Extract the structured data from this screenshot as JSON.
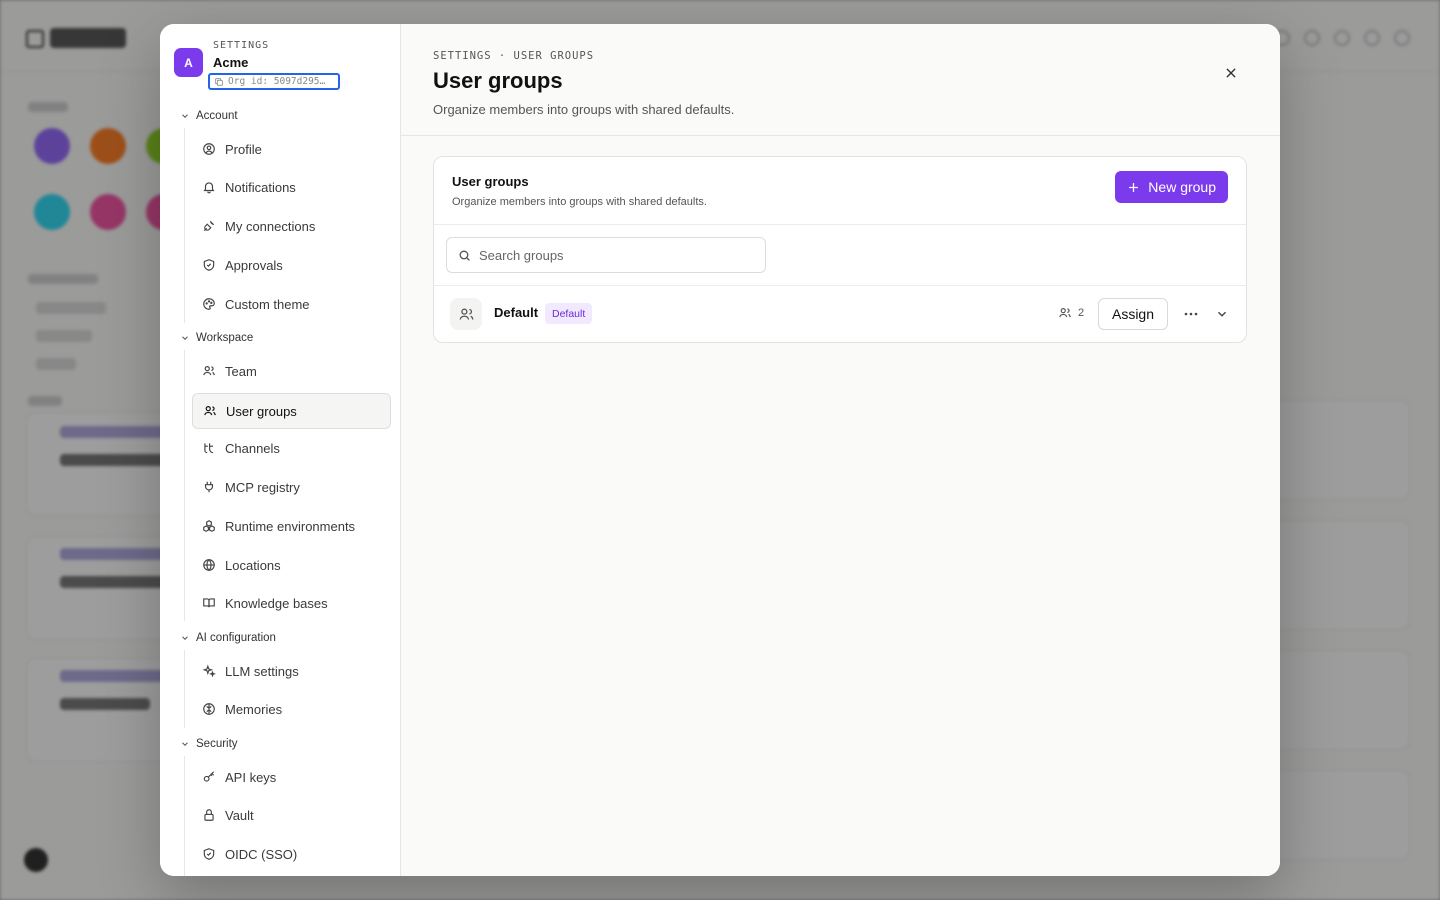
{
  "settings": {
    "org": {
      "kicker": "SETTINGS",
      "avatar_initial": "A",
      "name": "Acme",
      "id": "Org id: 5097d295…"
    },
    "sections": [
      {
        "label": "Account",
        "items": [
          {
            "label": "Profile",
            "icon": "user-circle-icon"
          },
          {
            "label": "Notifications",
            "icon": "bell-icon"
          },
          {
            "label": "My connections",
            "icon": "plug-icon"
          },
          {
            "label": "Approvals",
            "icon": "shield-check-icon"
          },
          {
            "label": "Custom theme",
            "icon": "palette-icon"
          }
        ]
      },
      {
        "label": "Workspace",
        "items": [
          {
            "label": "Team",
            "icon": "users-icon"
          },
          {
            "label": "User groups",
            "icon": "users-icon",
            "active": true
          },
          {
            "label": "Channels",
            "icon": "channels-icon"
          },
          {
            "label": "MCP registry",
            "icon": "plug-icon"
          },
          {
            "label": "Runtime environments",
            "icon": "boxes-icon"
          },
          {
            "label": "Locations",
            "icon": "globe-icon"
          },
          {
            "label": "Knowledge bases",
            "icon": "book-icon"
          }
        ]
      },
      {
        "label": "AI configuration",
        "items": [
          {
            "label": "LLM settings",
            "icon": "sparkles-icon"
          },
          {
            "label": "Memories",
            "icon": "brain-icon"
          }
        ]
      },
      {
        "label": "Security",
        "items": [
          {
            "label": "API keys",
            "icon": "key-icon"
          },
          {
            "label": "Vault",
            "icon": "lock-icon"
          },
          {
            "label": "OIDC (SSO)",
            "icon": "shield-check-icon"
          }
        ]
      }
    ]
  },
  "header": {
    "breadcrumb": "SETTINGS · USER GROUPS",
    "title": "User groups",
    "description": "Organize members into groups with shared defaults."
  },
  "card": {
    "title": "User groups",
    "description": "Organize members into groups with shared defaults.",
    "new_button": "New group",
    "search_placeholder": "Search groups",
    "groups": [
      {
        "name": "Default",
        "badge": "Default",
        "member_count": "2",
        "assign_label": "Assign"
      }
    ]
  },
  "colors": {
    "accent": "#7c3aed",
    "badge_bg": "#f1eafe",
    "focus_ring": "#2563eb"
  }
}
